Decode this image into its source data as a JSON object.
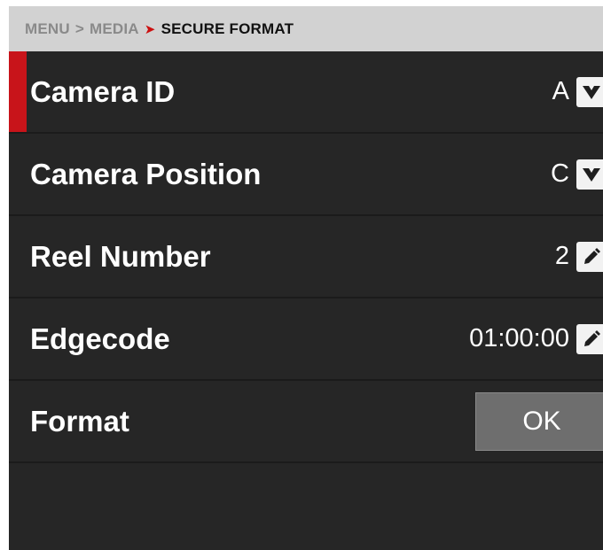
{
  "breadcrumb": {
    "items": [
      "MENU",
      "MEDIA",
      "SECURE FORMAT"
    ],
    "separators": [
      ">",
      ">"
    ]
  },
  "rows": [
    {
      "label": "Camera ID",
      "value": "A",
      "control": "dropdown"
    },
    {
      "label": "Camera Position",
      "value": "C",
      "control": "dropdown"
    },
    {
      "label": "Reel Number",
      "value": "2",
      "control": "edit"
    },
    {
      "label": "Edgecode",
      "value": "01:00:00",
      "control": "edit"
    },
    {
      "label": "Format",
      "button_label": "OK"
    }
  ],
  "colors": {
    "accent": "#c8141a",
    "background": "#262626",
    "header": "#d2d2d2"
  }
}
